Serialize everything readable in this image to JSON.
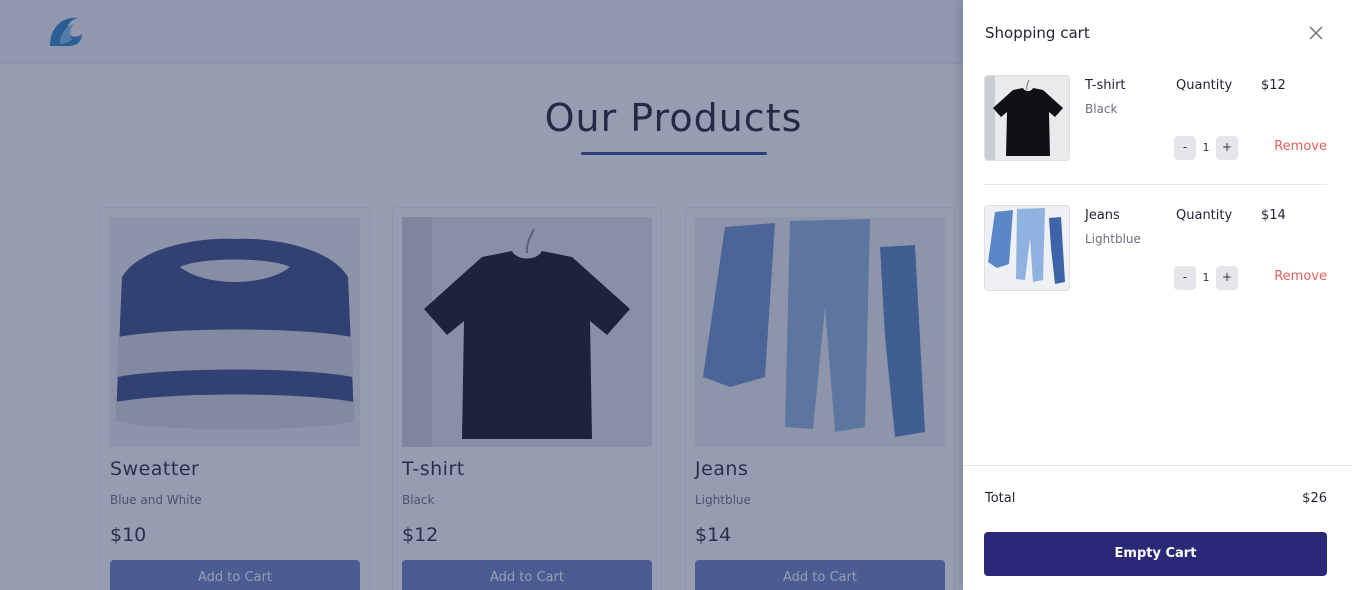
{
  "page": {
    "title": "Our Products",
    "colors": {
      "accent": "#3c4a98",
      "overlay": "#26325c",
      "button": "#6d80c7",
      "cart_button": "#2b2877",
      "remove": "#e4605a"
    },
    "products": [
      {
        "name": "Sweatter",
        "color": "Blue and White",
        "price": "$10",
        "button_label": "Add to Cart",
        "image_icon": "sweater-image"
      },
      {
        "name": "T-shirt",
        "color": "Black",
        "price": "$12",
        "button_label": "Add to Cart",
        "image_icon": "tshirt-image"
      },
      {
        "name": "Jeans",
        "color": "Lightblue",
        "price": "$14",
        "button_label": "Add to Cart",
        "image_icon": "jeans-image"
      }
    ]
  },
  "cart": {
    "title": "Shopping cart",
    "close_icon": "close-icon",
    "items": [
      {
        "name": "T-shirt",
        "color": "Black",
        "quantity_label": "Quantity",
        "price": "$12",
        "quantity": "1",
        "minus": "-",
        "plus": "+",
        "remove_label": "Remove"
      },
      {
        "name": "Jeans",
        "color": "Lightblue",
        "quantity_label": "Quantity",
        "price": "$14",
        "quantity": "1",
        "minus": "-",
        "plus": "+",
        "remove_label": "Remove"
      }
    ],
    "total_label": "Total",
    "total_value": "$26",
    "empty_label": "Empty Cart"
  }
}
